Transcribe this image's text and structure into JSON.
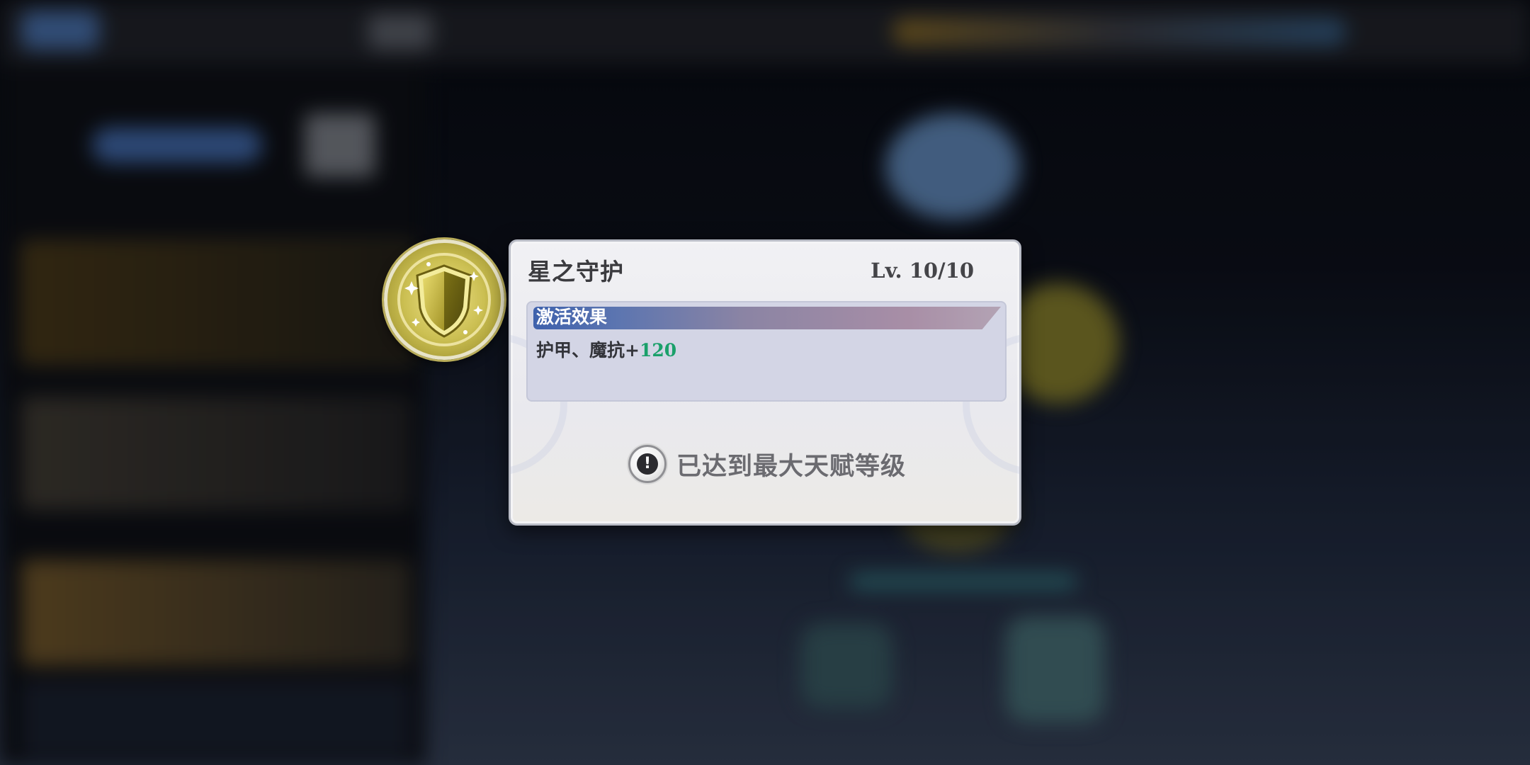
{
  "talent_popup": {
    "title": "星之守护",
    "level": "Lv.  10/10",
    "effect_header": "激活效果",
    "effect_prefix": "护甲、魔抗+",
    "effect_value": "120",
    "maxed_message": "已达到最大天赋等级"
  },
  "icons": {
    "talent": "shield-sparkle-icon",
    "warning": "exclamation-icon"
  },
  "colors": {
    "effect_value": "#1aa06a",
    "effect_header": "#3e61ac"
  }
}
